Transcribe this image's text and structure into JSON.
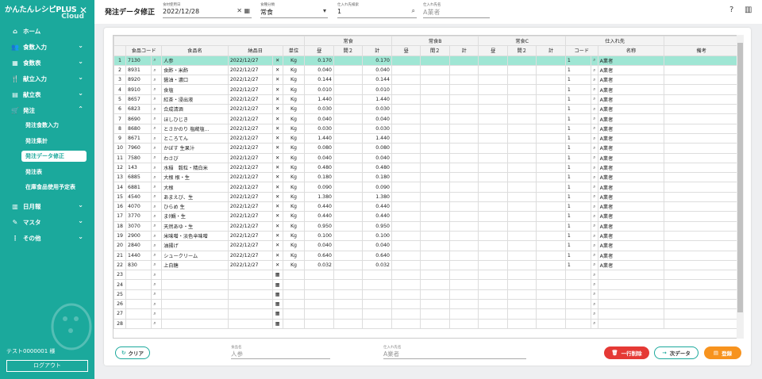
{
  "app": {
    "brand_line1": "かんたんレシピPLUS",
    "brand_line2": "Cloud",
    "close": "✕",
    "user": "テスト0000001 様",
    "logout": "ログアウト"
  },
  "nav": [
    {
      "label": "ホーム",
      "icon": "home-icon",
      "glyph": "⌂",
      "chevron": ""
    },
    {
      "label": "食数入力",
      "icon": "people-icon",
      "glyph": "👥",
      "chevron": "⌄"
    },
    {
      "label": "食数表",
      "icon": "table-icon",
      "glyph": "▦",
      "chevron": "⌄"
    },
    {
      "label": "献立入力",
      "icon": "fork-knife-icon",
      "glyph": "🍴",
      "chevron": "⌄"
    },
    {
      "label": "献立表",
      "icon": "calendar-icon",
      "glyph": "▤",
      "chevron": "⌄"
    },
    {
      "label": "発注",
      "icon": "cart-icon",
      "glyph": "🛒",
      "chevron": "⌃"
    }
  ],
  "subnav": [
    "発注食数入力",
    "発注集計",
    "発注データ修正",
    "発注表",
    "在庫食品使用予定表"
  ],
  "nav2": [
    {
      "label": "日月報",
      "icon": "book-icon",
      "glyph": "▥",
      "chevron": "⌄"
    },
    {
      "label": "マスタ",
      "icon": "pencil-icon",
      "glyph": "✎",
      "chevron": "⌄"
    },
    {
      "label": "その他",
      "icon": "more-icon",
      "glyph": "⋮",
      "chevron": "⌄"
    }
  ],
  "topbar": {
    "title": "発注データ修正",
    "date_label": "食材使用日",
    "date_value": "2022/12/28",
    "meal_label": "食種分類",
    "meal_value": "常食",
    "supplier_label": "仕入れ先検索",
    "supplier_value": "1",
    "supplier_name_label": "仕入れ先名",
    "supplier_name_placeholder": "A業者"
  },
  "headers": {
    "food_code": "食品コード",
    "food_name": "食品名",
    "delivery": "納品日",
    "unit": "単位",
    "g1": "常食",
    "g2": "常食B",
    "g3": "常食C",
    "g4": "仕入れ先",
    "hiru": "昼",
    "kan2": "間２",
    "total": "計",
    "code": "コード",
    "name": "名称",
    "note": "備考"
  },
  "rows": [
    {
      "no": "1",
      "code": "7130",
      "name": "人参",
      "date": "2022/12/27",
      "unit": "Kg",
      "hiru": "0.170",
      "total": "0.170",
      "sup": "1",
      "supname": "A業者"
    },
    {
      "no": "2",
      "code": "8931",
      "name": "食酢・米酢",
      "date": "2022/12/27",
      "unit": "Kg",
      "hiru": "0.040",
      "total": "0.040",
      "sup": "1",
      "supname": "A業者"
    },
    {
      "no": "3",
      "code": "8920",
      "name": "醤油・濃口",
      "date": "2022/12/27",
      "unit": "Kg",
      "hiru": "0.144",
      "total": "0.144",
      "sup": "1",
      "supname": "A業者"
    },
    {
      "no": "4",
      "code": "8910",
      "name": "食塩",
      "date": "2022/12/27",
      "unit": "Kg",
      "hiru": "0.010",
      "total": "0.010",
      "sup": "1",
      "supname": "A業者"
    },
    {
      "no": "5",
      "code": "8657",
      "name": "紅茶・浸出液",
      "date": "2022/12/27",
      "unit": "Kg",
      "hiru": "1.440",
      "total": "1.440",
      "sup": "1",
      "supname": "A業者"
    },
    {
      "no": "6",
      "code": "6823",
      "name": "合成清酒",
      "date": "2022/12/27",
      "unit": "Kg",
      "hiru": "0.030",
      "total": "0.030",
      "sup": "1",
      "supname": "A業者"
    },
    {
      "no": "7",
      "code": "8690",
      "name": "ほしひじき",
      "date": "2022/12/27",
      "unit": "Kg",
      "hiru": "0.040",
      "total": "0.040",
      "sup": "1",
      "supname": "A業者"
    },
    {
      "no": "8",
      "code": "8680",
      "name": "とさかのり 塩蔵塩...",
      "date": "2022/12/27",
      "unit": "Kg",
      "hiru": "0.030",
      "total": "0.030",
      "sup": "1",
      "supname": "A業者"
    },
    {
      "no": "9",
      "code": "8671",
      "name": "ところてん",
      "date": "2022/12/27",
      "unit": "Kg",
      "hiru": "1.440",
      "total": "1.440",
      "sup": "1",
      "supname": "A業者"
    },
    {
      "no": "10",
      "code": "7960",
      "name": "かぼす 生果汁",
      "date": "2022/12/27",
      "unit": "Kg",
      "hiru": "0.080",
      "total": "0.080",
      "sup": "1",
      "supname": "A業者"
    },
    {
      "no": "11",
      "code": "7580",
      "name": "わさび",
      "date": "2022/12/27",
      "unit": "Kg",
      "hiru": "0.040",
      "total": "0.040",
      "sup": "1",
      "supname": "A業者"
    },
    {
      "no": "12",
      "code": "143",
      "name": "水稲　穀粒・精白米",
      "date": "2022/12/27",
      "unit": "Kg",
      "hiru": "0.480",
      "total": "0.480",
      "sup": "1",
      "supname": "A業者"
    },
    {
      "no": "13",
      "code": "6885",
      "name": "大根 根・生",
      "date": "2022/12/27",
      "unit": "Kg",
      "hiru": "0.180",
      "total": "0.180",
      "sup": "1",
      "supname": "A業者"
    },
    {
      "no": "14",
      "code": "6881",
      "name": "大根",
      "date": "2022/12/27",
      "unit": "Kg",
      "hiru": "0.090",
      "total": "0.090",
      "sup": "1",
      "supname": "A業者"
    },
    {
      "no": "15",
      "code": "4540",
      "name": "あまえび、生",
      "date": "2022/12/27",
      "unit": "Kg",
      "hiru": "1.380",
      "total": "1.380",
      "sup": "1",
      "supname": "A業者"
    },
    {
      "no": "16",
      "code": "4070",
      "name": "ひらめ 生",
      "date": "2022/12/27",
      "unit": "Kg",
      "hiru": "0.440",
      "total": "0.440",
      "sup": "1",
      "supname": "A業者"
    },
    {
      "no": "17",
      "code": "3770",
      "name": "まﾀ鯛・生",
      "date": "2022/12/27",
      "unit": "Kg",
      "hiru": "0.440",
      "total": "0.440",
      "sup": "1",
      "supname": "A業者"
    },
    {
      "no": "18",
      "code": "3070",
      "name": "天然あゆ・生",
      "date": "2022/12/27",
      "unit": "Kg",
      "hiru": "0.950",
      "total": "0.950",
      "sup": "1",
      "supname": "A業者"
    },
    {
      "no": "19",
      "code": "2900",
      "name": "米味噌・淡色辛味噌",
      "date": "2022/12/27",
      "unit": "Kg",
      "hiru": "0.100",
      "total": "0.100",
      "sup": "1",
      "supname": "A業者"
    },
    {
      "no": "20",
      "code": "2840",
      "name": "油揚げ",
      "date": "2022/12/27",
      "unit": "Kg",
      "hiru": "0.040",
      "total": "0.040",
      "sup": "1",
      "supname": "A業者"
    },
    {
      "no": "21",
      "code": "1440",
      "name": "シュークリーム",
      "date": "2022/12/27",
      "unit": "Kg",
      "hiru": "0.640",
      "total": "0.640",
      "sup": "1",
      "supname": "A業者"
    },
    {
      "no": "22",
      "code": "830",
      "name": "上白糖",
      "date": "2022/12/27",
      "unit": "Kg",
      "hiru": "0.032",
      "total": "0.032",
      "sup": "1",
      "supname": "A業者"
    },
    {
      "no": "23"
    },
    {
      "no": "24"
    },
    {
      "no": "25"
    },
    {
      "no": "26"
    },
    {
      "no": "27"
    },
    {
      "no": "28"
    }
  ],
  "footer": {
    "clear": "クリア",
    "food_name_label": "食品名",
    "food_name_placeholder": "人参",
    "supplier_label": "仕入れ先名",
    "supplier_placeholder": "A業者",
    "delete": "一行削除",
    "next": "次データ",
    "save": "登録"
  }
}
